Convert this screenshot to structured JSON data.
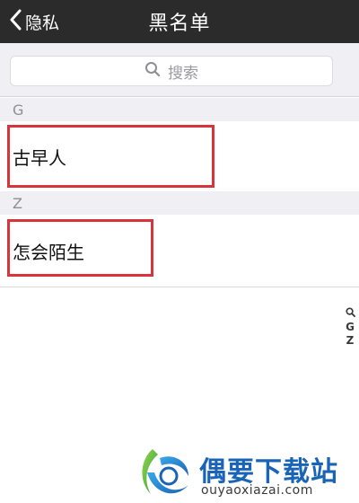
{
  "navbar": {
    "back_label": "隐私",
    "title": "黑名单"
  },
  "search": {
    "placeholder": "搜索"
  },
  "sections": [
    {
      "letter": "G",
      "contacts": [
        "古早人"
      ]
    },
    {
      "letter": "Z",
      "contacts": [
        "怎会陌生"
      ]
    }
  ],
  "index_bar": {
    "icon": "search-icon",
    "letters": [
      "G",
      "Z"
    ]
  },
  "watermark": {
    "name": "偶要下载站",
    "url": "ouyaoxiazai.com"
  },
  "colors": {
    "navbar": "#2b2b2b",
    "highlight": "#d9343a",
    "section_bg": "#efeff4",
    "watermark_blue": "#1a64b8"
  }
}
